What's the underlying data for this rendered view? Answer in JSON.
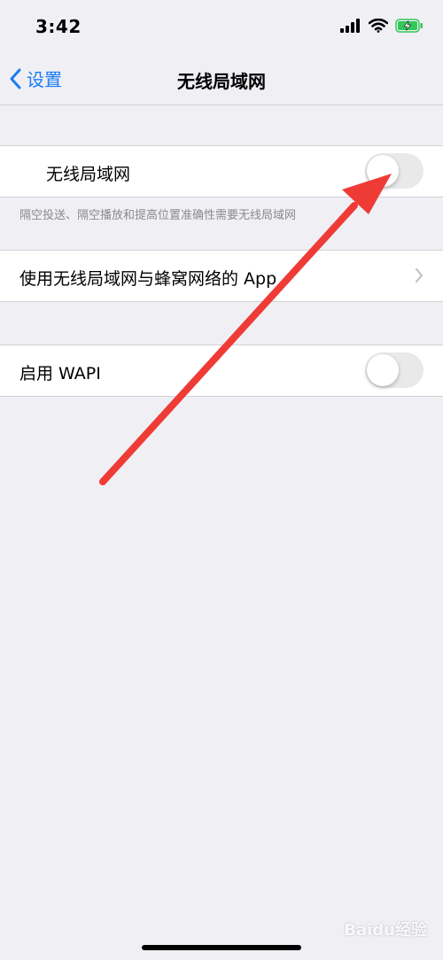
{
  "status_bar": {
    "time": "3:42",
    "icons": [
      "cellular-signal-icon",
      "wifi-icon",
      "battery-charging-icon"
    ]
  },
  "nav": {
    "back_label": "设置",
    "title": "无线局域网"
  },
  "wlan_row": {
    "label": "无线局域网",
    "switch_on": false
  },
  "wlan_footnote": "隔空投送、隔空播放和提高位置准确性需要无线局域网",
  "apps_row": {
    "label": "使用无线局域网与蜂窝网络的 App"
  },
  "wapi_row": {
    "label": "启用 WAPI",
    "switch_on": false
  },
  "watermark": "Baidu经验",
  "colors": {
    "accent": "#1a7cf5",
    "annotation_arrow": "#ef3b36",
    "switch_off_bg": "#e9e9ea",
    "battery_fill": "#34c759"
  }
}
